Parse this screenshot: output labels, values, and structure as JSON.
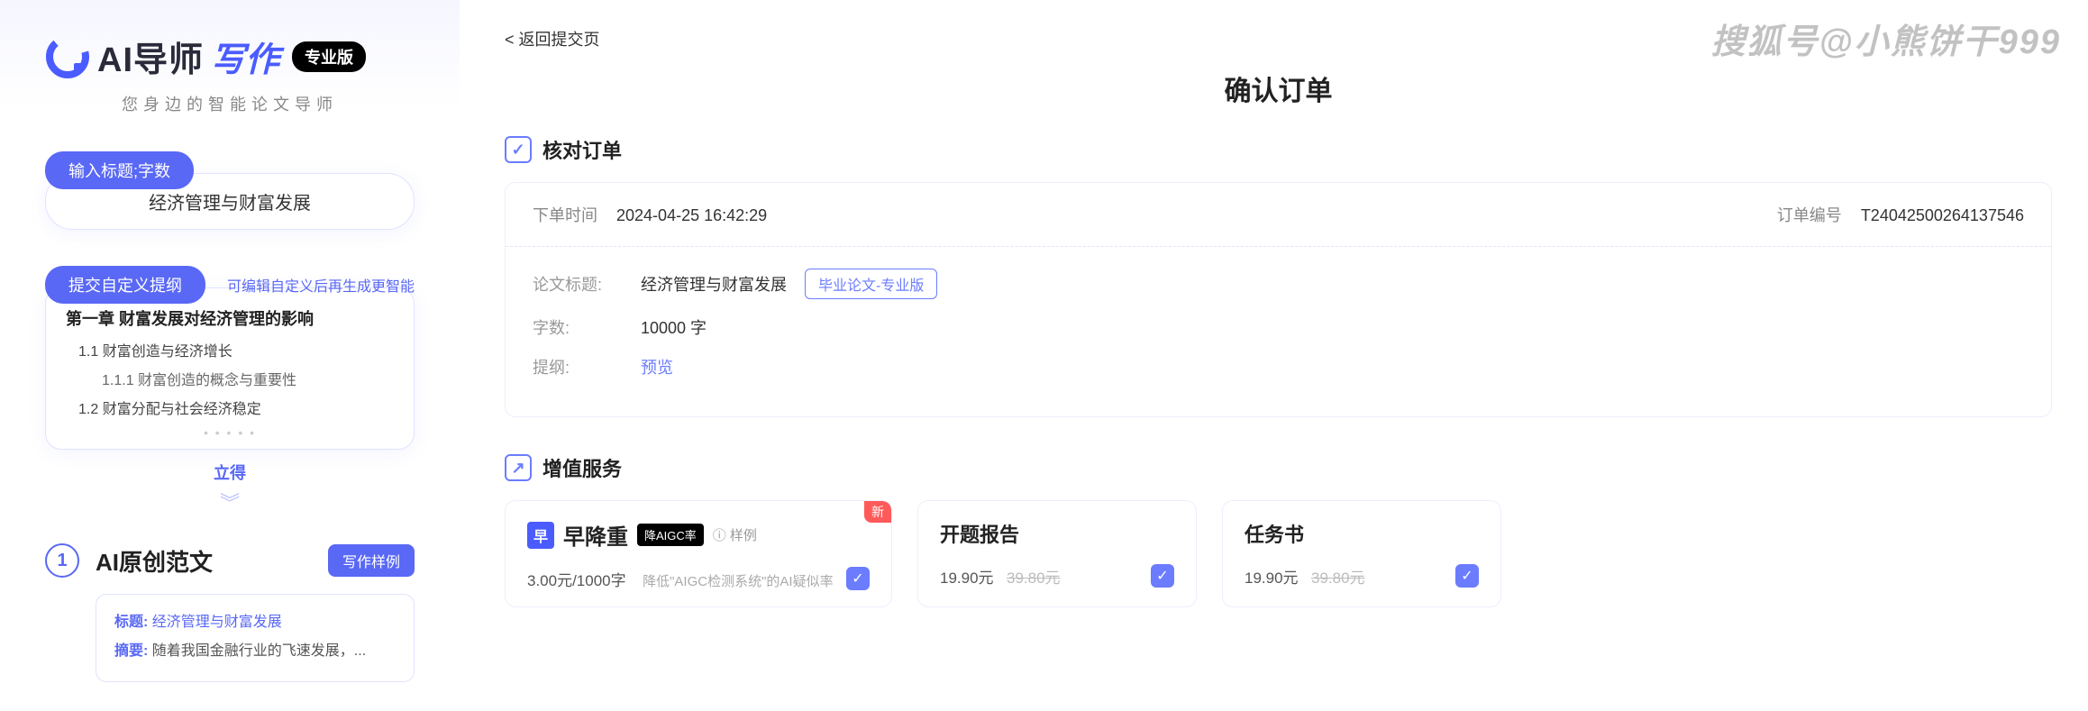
{
  "watermark": "搜狐号@小熊饼干999",
  "left": {
    "logo_main": "AI导师",
    "logo_write": "写作",
    "pro": "专业版",
    "slogan": "您身边的智能论文导师",
    "input_label": "输入标题;字数",
    "topic": "经济管理与财富发展",
    "outline_label": "提交自定义提纲",
    "outline_hint": "可编辑自定义后再生成更智能",
    "chapter1": "第一章 财富发展对经济管理的影响",
    "sec11": "1.1 财富创造与经济增长",
    "sec111": "1.1.1 财富创造的概念与重要性",
    "sec12": "1.2 财富分配与社会经济稳定",
    "get": "立得",
    "step1_num": "1",
    "sample_title": "AI原创范文",
    "sample_btn": "写作样例",
    "sample_topic_lbl": "标题:",
    "sample_topic_val": "经济管理与财富发展",
    "sample_abs_lbl": "摘要:",
    "sample_abs_val": "随着我国金融行业的飞速发展，..."
  },
  "right": {
    "back": "< 返回提交页",
    "title": "确认订单",
    "sec1": "核对订单",
    "order_time_lbl": "下单时间",
    "order_time": "2024-04-25 16:42:29",
    "order_no_lbl": "订单编号",
    "order_no": "T24042500264137546",
    "topic_lbl": "论文标题:",
    "topic_val": "经济管理与财富发展",
    "type_tag": "毕业论文-专业版",
    "wc_lbl": "字数:",
    "wc_val": "10000 字",
    "outline_lbl": "提纲:",
    "outline_val": "预览",
    "sec2": "增值服务",
    "svc1_logo": "早降重",
    "svc1_tag": "降AIGC率",
    "svc1_example": "样例",
    "svc1_new": "新",
    "svc1_price": "3.00元/1000字",
    "svc1_desc": "降低\"AIGC检测系统\"的AI疑似率",
    "svc2_title": "开题报告",
    "svc2_price": "19.90元",
    "svc2_old": "39.80元",
    "svc3_title": "任务书",
    "svc3_price": "19.90元",
    "svc3_old": "39.80元"
  }
}
